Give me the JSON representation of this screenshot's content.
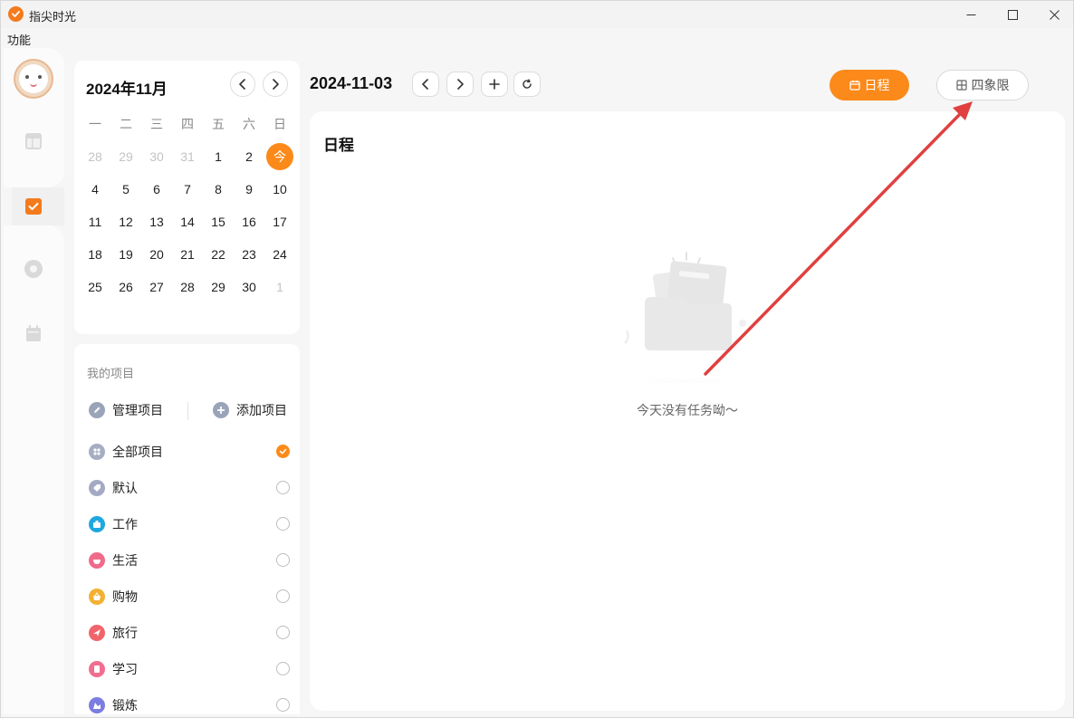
{
  "window": {
    "title": "指尖时光",
    "menu": [
      "功能"
    ]
  },
  "colors": {
    "accent": "#fb8a1a",
    "annotation": "#e04040"
  },
  "rail": {
    "items": [
      "layout-icon",
      "task-check-icon",
      "focus-circle-icon",
      "calendar-box-icon"
    ],
    "selected": "task-check-icon"
  },
  "calendar": {
    "title": "2024年11月",
    "weekdays": [
      "一",
      "二",
      "三",
      "四",
      "五",
      "六",
      "日"
    ],
    "weeks": [
      [
        {
          "d": "28",
          "m": true
        },
        {
          "d": "29",
          "m": true
        },
        {
          "d": "30",
          "m": true
        },
        {
          "d": "31",
          "m": true
        },
        {
          "d": "1"
        },
        {
          "d": "2"
        },
        {
          "d": "今",
          "today": true
        }
      ],
      [
        {
          "d": "4"
        },
        {
          "d": "5"
        },
        {
          "d": "6"
        },
        {
          "d": "7"
        },
        {
          "d": "8"
        },
        {
          "d": "9"
        },
        {
          "d": "10"
        }
      ],
      [
        {
          "d": "11"
        },
        {
          "d": "12"
        },
        {
          "d": "13"
        },
        {
          "d": "14"
        },
        {
          "d": "15"
        },
        {
          "d": "16"
        },
        {
          "d": "17"
        }
      ],
      [
        {
          "d": "18"
        },
        {
          "d": "19"
        },
        {
          "d": "20"
        },
        {
          "d": "21"
        },
        {
          "d": "22"
        },
        {
          "d": "23"
        },
        {
          "d": "24"
        }
      ],
      [
        {
          "d": "25"
        },
        {
          "d": "26"
        },
        {
          "d": "27"
        },
        {
          "d": "28"
        },
        {
          "d": "29"
        },
        {
          "d": "30"
        },
        {
          "d": "1",
          "m": true
        }
      ]
    ]
  },
  "projects": {
    "heading": "我的项目",
    "manage_label": "管理项目",
    "add_label": "添加项目",
    "items": [
      {
        "label": "全部项目",
        "color": "#a7aec2",
        "checked": true
      },
      {
        "label": "默认",
        "color": "#a4a9c4",
        "checked": false
      },
      {
        "label": "工作",
        "color": "#1fa7e0",
        "checked": false
      },
      {
        "label": "生活",
        "color": "#f06a8a",
        "checked": false
      },
      {
        "label": "购物",
        "color": "#f2b134",
        "checked": false
      },
      {
        "label": "旅行",
        "color": "#f0646b",
        "checked": false
      },
      {
        "label": "学习",
        "color": "#f26d8f",
        "checked": false
      },
      {
        "label": "锻炼",
        "color": "#7b7de0",
        "checked": false
      }
    ]
  },
  "main": {
    "date": "2024-11-03",
    "views": {
      "schedule_label": "日程",
      "quadrant_label": "四象限"
    },
    "panel_title": "日程",
    "empty_text": "今天没有任务呦～"
  }
}
